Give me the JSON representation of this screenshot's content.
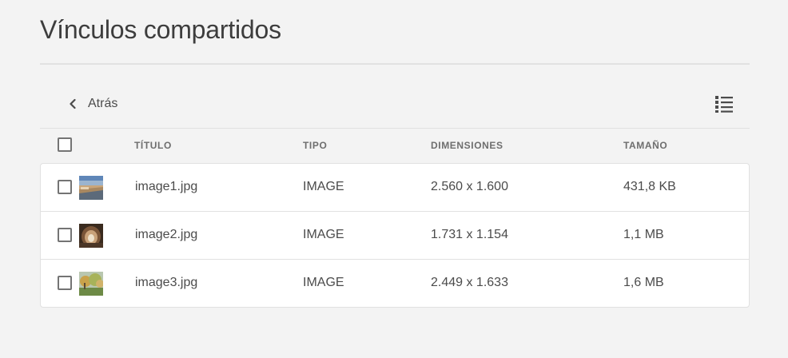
{
  "page": {
    "title": "Vínculos compartidos"
  },
  "toolbar": {
    "back_label": "Atrás",
    "back_icon": "chevron-left-icon",
    "view_icon": "list-view-icon"
  },
  "table": {
    "columns": {
      "title": "TÍTULO",
      "type": "TIPO",
      "dimensions": "DIMENSIONES",
      "size": "TAMAÑO"
    },
    "rows": [
      {
        "name": "image1.jpg",
        "type": "IMAGE",
        "dimensions": "2.560 x 1.600",
        "size": "431,8 KB",
        "thumbnail": "beach-landscape"
      },
      {
        "name": "image2.jpg",
        "type": "IMAGE",
        "dimensions": "1.731 x 1.154",
        "size": "1,1 MB",
        "thumbnail": "tunnel-interior"
      },
      {
        "name": "image3.jpg",
        "type": "IMAGE",
        "dimensions": "2.449 x 1.633",
        "size": "1,6 MB",
        "thumbnail": "autumn-trees"
      }
    ]
  }
}
